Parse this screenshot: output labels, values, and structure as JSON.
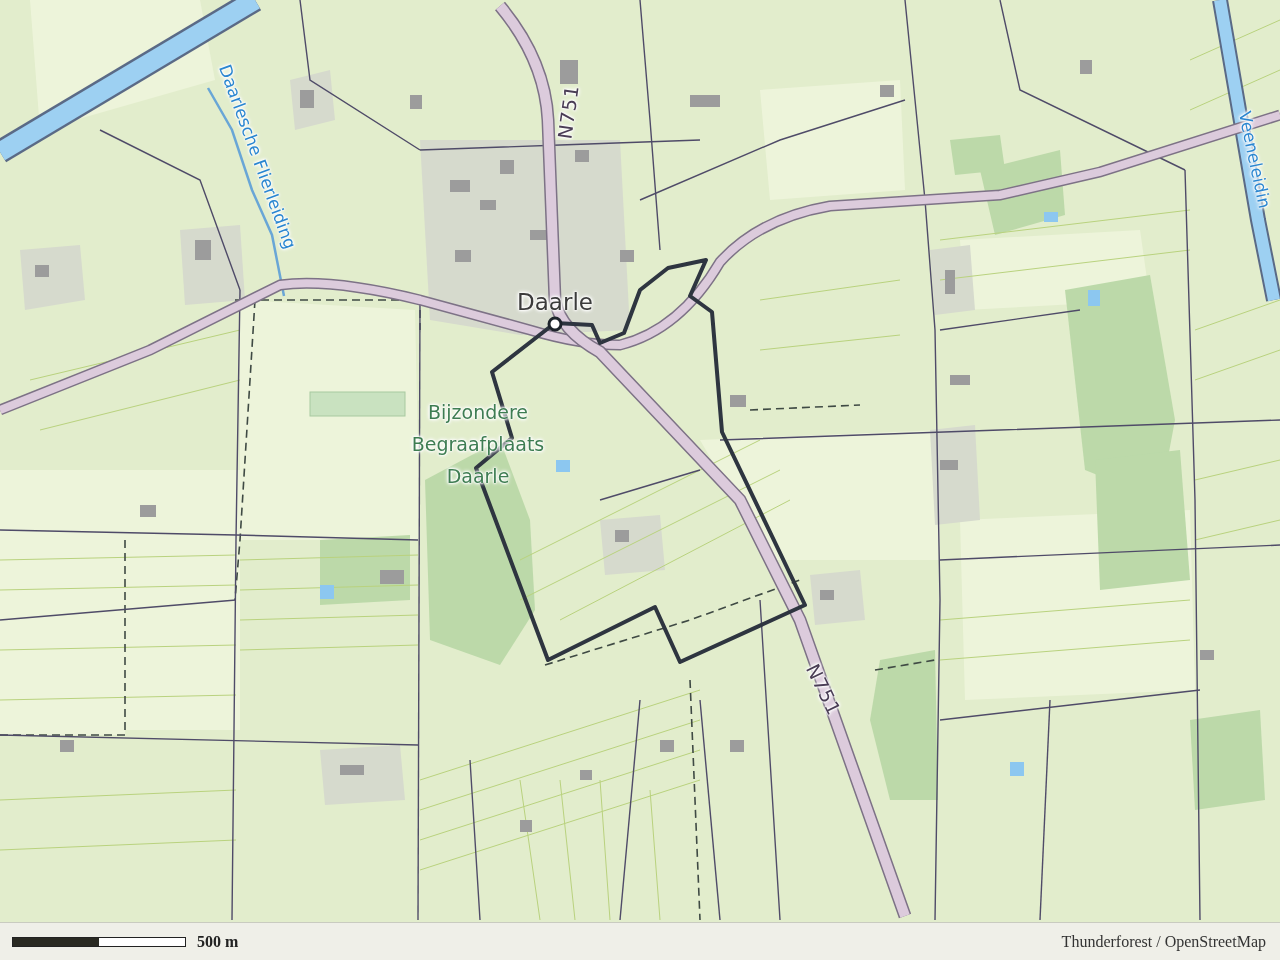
{
  "map": {
    "labels": [
      {
        "kind": "place",
        "text": "Daarle"
      },
      {
        "kind": "road",
        "text": "N751"
      },
      {
        "kind": "road",
        "text": "N751"
      },
      {
        "kind": "water",
        "text": "Daarlesche Flierleiding"
      },
      {
        "kind": "water",
        "text": "Veeneleidin"
      },
      {
        "kind": "park",
        "text": "Bijzondere Begraafplaats Daarle"
      }
    ]
  },
  "scale_bar": {
    "label": "500 m"
  },
  "attribution": "Thunderforest / OpenStreetMap"
}
